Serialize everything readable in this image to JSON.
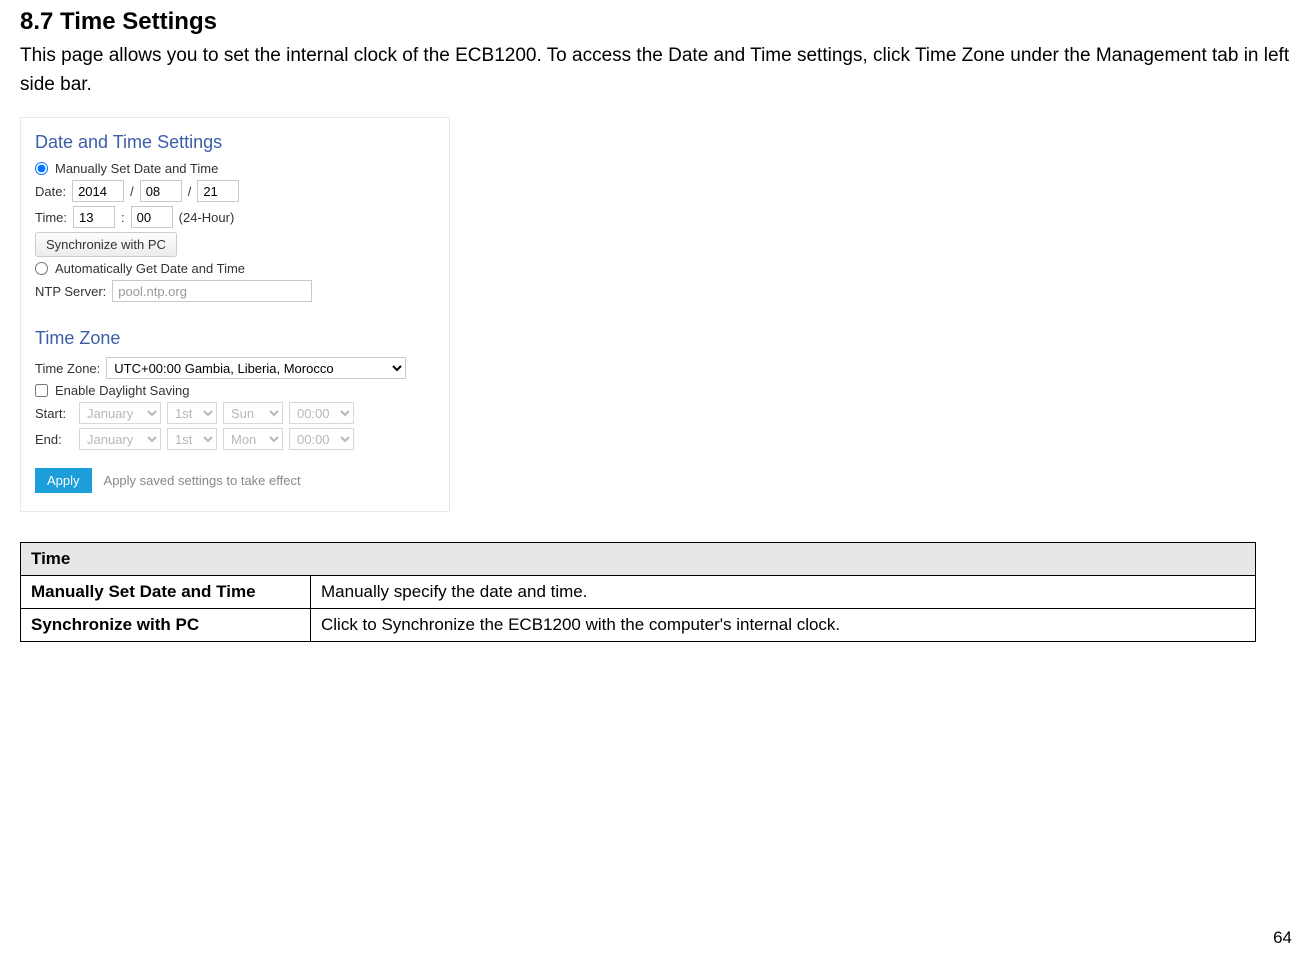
{
  "heading": "8.7   Time Settings",
  "intro": "This page allows you to set the internal clock of the ECB1200. To access the Date and Time settings, click Time Zone under the Management tab in left side bar.",
  "shot": {
    "panel_datetime": "Date and Time Settings",
    "radio_manual": "Manually Set Date and Time",
    "date_label": "Date:",
    "date_year": "2014",
    "date_month": "08",
    "date_day": "21",
    "time_label": "Time:",
    "time_hour": "13",
    "time_min": "00",
    "time_format": "(24-Hour)",
    "sync_btn": "Synchronize with PC",
    "radio_auto": "Automatically Get Date and Time",
    "ntp_label": "NTP Server:",
    "ntp_value": "pool.ntp.org",
    "panel_timezone": "Time Zone",
    "tz_label": "Time Zone:",
    "tz_value": "UTC+00:00 Gambia, Liberia, Morocco",
    "dst_check": "Enable Daylight Saving",
    "start_label": "Start:",
    "end_label": "End:",
    "month_jan": "January",
    "week_1st": "1st",
    "day_sun": "Sun",
    "day_mon": "Mon",
    "time_0000": "00:00",
    "apply_btn": "Apply",
    "apply_note": "Apply saved settings to take effect"
  },
  "table": {
    "header": "Time",
    "rows": [
      {
        "key": "Manually Set Date and Time",
        "val": "Manually specify the date and time."
      },
      {
        "key": "Synchronize with PC",
        "val": "Click to Synchronize the ECB1200 with the computer's internal clock."
      }
    ]
  },
  "page_number": "64"
}
